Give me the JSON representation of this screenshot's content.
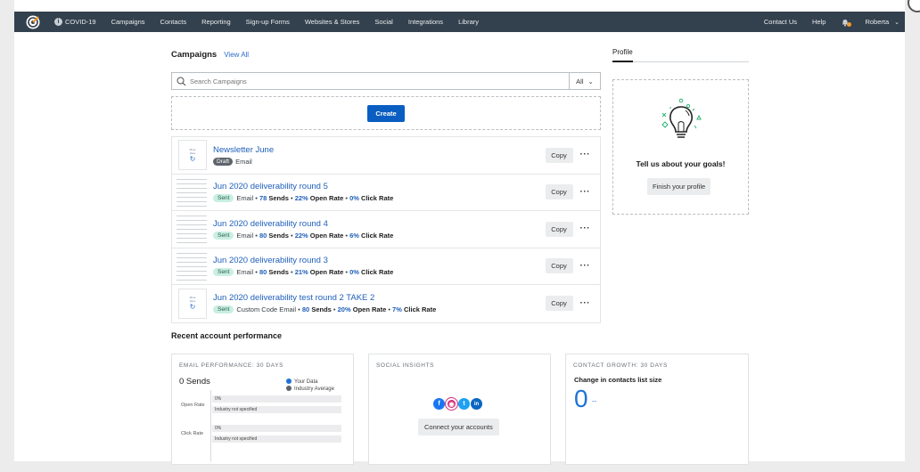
{
  "nav": {
    "items": [
      "COVID-19",
      "Campaigns",
      "Contacts",
      "Reporting",
      "Sign-up Forms",
      "Websites & Stores",
      "Social",
      "Integrations",
      "Library"
    ],
    "right": {
      "contact": "Contact Us",
      "help": "Help",
      "user": "Roberta"
    }
  },
  "campaigns": {
    "title": "Campaigns",
    "view_all": "View All",
    "search_placeholder": "Search Campaigns",
    "filter": "All",
    "create": "Create",
    "copy_label": "Copy",
    "thumb_text": "More\nHere",
    "rows": [
      {
        "title": "Newsletter June",
        "status": "Draft",
        "type": "Email"
      },
      {
        "title": "Jun 2020 deliverability round 5",
        "status": "Sent",
        "type": "Email",
        "sends": "78",
        "sends_label": "Sends",
        "open": "22%",
        "open_label": "Open Rate",
        "click": "0%",
        "click_label": "Click Rate"
      },
      {
        "title": "Jun 2020 deliverability round 4",
        "status": "Sent",
        "type": "Email",
        "sends": "80",
        "sends_label": "Sends",
        "open": "22%",
        "open_label": "Open Rate",
        "click": "6%",
        "click_label": "Click Rate"
      },
      {
        "title": "Jun 2020 deliverability round 3",
        "status": "Sent",
        "type": "Email",
        "sends": "80",
        "sends_label": "Sends",
        "open": "21%",
        "open_label": "Open Rate",
        "click": "0%",
        "click_label": "Click Rate"
      },
      {
        "title": "Jun 2020 deliverability test round 2 TAKE 2",
        "status": "Sent",
        "type": "Custom Code Email",
        "sends": "80",
        "sends_label": "Sends",
        "open": "20%",
        "open_label": "Open Rate",
        "click": "7%",
        "click_label": "Click Rate"
      }
    ]
  },
  "recent": {
    "title": "Recent account performance",
    "email": {
      "caption": "EMAIL PERFORMANCE: 30 DAYS",
      "sends": "0 Sends",
      "legend_yours": "Your Data",
      "legend_industry": "Industry Average",
      "open_label": "Open Rate",
      "click_label": "Click Rate",
      "open_value": "0%",
      "click_value": "0%",
      "industry_note": "Industry not specified"
    },
    "social": {
      "caption": "SOCIAL INSIGHTS",
      "connect": "Connect your accounts"
    },
    "growth": {
      "caption": "CONTACT GROWTH: 30 DAYS",
      "title": "Change in contacts list size",
      "value": "0",
      "dash": "--"
    }
  },
  "profile": {
    "tab": "Profile",
    "goal_text": "Tell us about your goals!",
    "finish": "Finish your profile"
  },
  "colors": {
    "nav_bg": "#33404d",
    "primary": "#0a5ec2",
    "link": "#1e5fba",
    "sent_badge": "#c8efe2",
    "draft_badge": "#5d646b"
  }
}
